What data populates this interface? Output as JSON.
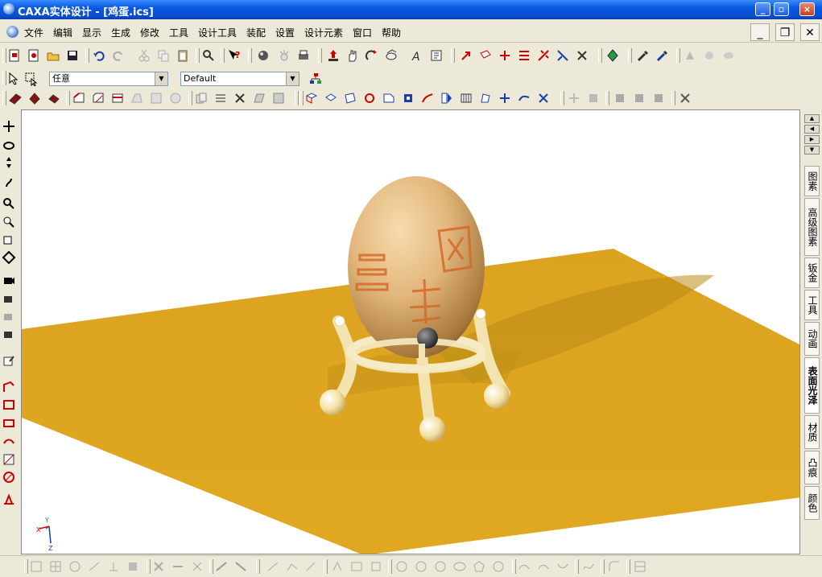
{
  "window": {
    "title": "CAXA实体设计 - [鸡蛋.ics]",
    "minimize_glyph": "_",
    "restore_glyph": "▫",
    "close_glyph": "×"
  },
  "menubar": {
    "items": [
      "文件",
      "编辑",
      "显示",
      "生成",
      "修改",
      "工具",
      "设计工具",
      "装配",
      "设置",
      "设计元素",
      "窗口",
      "帮助"
    ],
    "mdi_controls": [
      "_",
      "❐",
      "✕"
    ]
  },
  "selectors": {
    "filter_value": "任意",
    "config_value": "Default"
  },
  "right_tabs": [
    "图素",
    "高级图素",
    "钣金",
    "工具",
    "动画",
    "表面光泽",
    "材质",
    "凸痕",
    "颜色"
  ],
  "active_right_tab": "表面光泽",
  "scene": {
    "floor_color": "#dba320",
    "egg_color": "#e3b67c",
    "stand_color": "#f5e6b0",
    "background": "#ffffff",
    "egg_characters": [
      "三",
      "維",
      "网"
    ]
  },
  "axis_triad": {
    "x": "X",
    "y": "Y",
    "z": "Z"
  }
}
